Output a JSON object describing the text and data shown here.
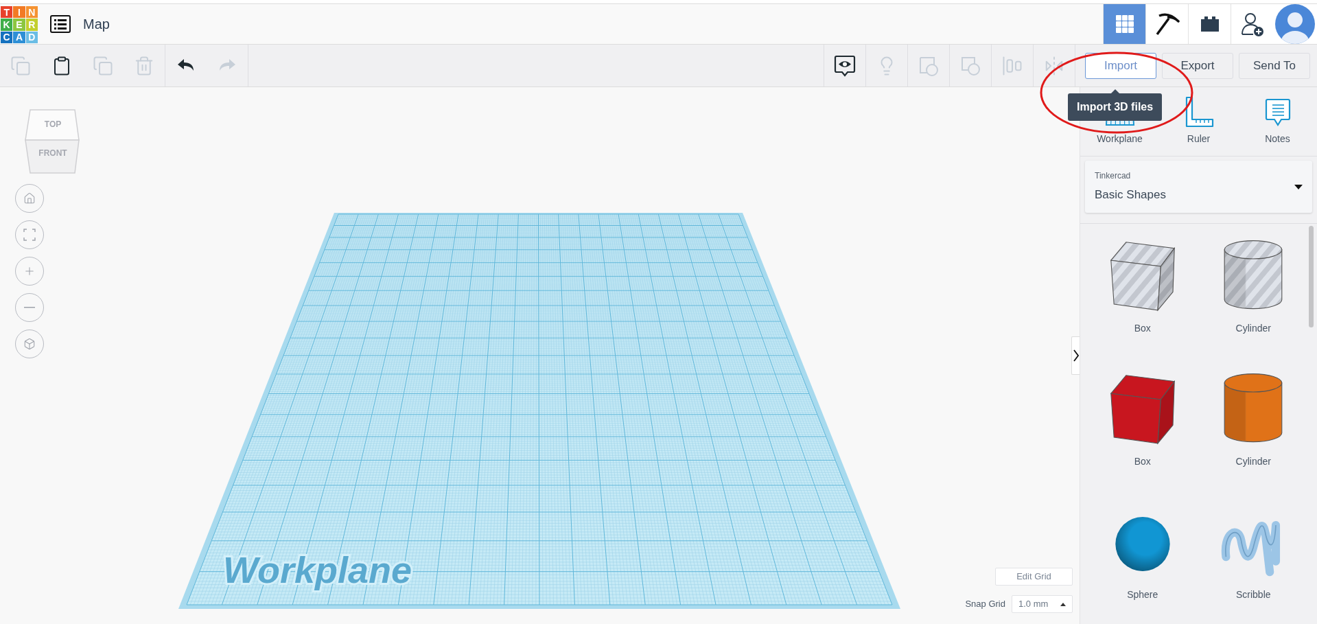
{
  "logo": {
    "letters": [
      {
        "char": "T",
        "color": "#e8412c"
      },
      {
        "char": "I",
        "color": "#f27a24"
      },
      {
        "char": "N",
        "color": "#f59331"
      },
      {
        "char": "K",
        "color": "#3fae49"
      },
      {
        "char": "E",
        "color": "#8cc63f"
      },
      {
        "char": "R",
        "color": "#c3cf2e"
      },
      {
        "char": "C",
        "color": "#1571bf"
      },
      {
        "char": "A",
        "color": "#2e8fd6"
      },
      {
        "char": "D",
        "color": "#6bbde5"
      }
    ]
  },
  "header": {
    "title": "Map",
    "modes": [
      {
        "kind": "grid",
        "selected": true
      },
      {
        "kind": "pickaxe",
        "selected": false
      },
      {
        "kind": "brick",
        "selected": false
      }
    ]
  },
  "toolbar": {
    "edit_tools": [
      {
        "kind": "copy",
        "disabled": true
      },
      {
        "kind": "paste",
        "disabled": false
      },
      {
        "kind": "duplicate",
        "disabled": true
      },
      {
        "kind": "delete",
        "disabled": true
      }
    ],
    "history_tools": [
      {
        "kind": "undo",
        "disabled": false
      },
      {
        "kind": "redo",
        "disabled": true
      }
    ],
    "view_tools": [
      {
        "kind": "notes",
        "disabled": false
      },
      {
        "kind": "bulb",
        "disabled": true
      },
      {
        "kind": "group",
        "disabled": true
      },
      {
        "kind": "ungroup",
        "disabled": true
      },
      {
        "kind": "align",
        "disabled": true
      },
      {
        "kind": "mirror",
        "disabled": true
      }
    ],
    "actions": [
      {
        "label": "Import",
        "hovered": true
      },
      {
        "label": "Export",
        "hovered": false
      },
      {
        "label": "Send To",
        "hovered": false
      }
    ]
  },
  "tooltip": "Import 3D files",
  "panel": {
    "tools": [
      {
        "kind": "workplane",
        "label": "Workplane"
      },
      {
        "kind": "ruler",
        "label": "Ruler"
      },
      {
        "kind": "notes",
        "label": "Notes"
      }
    ],
    "library": {
      "source": "Tinkercad",
      "name": "Basic Shapes"
    },
    "shapes": [
      {
        "kind": "box",
        "label": "Box",
        "hole": true,
        "color": "#c3c7cf"
      },
      {
        "kind": "cylinder",
        "label": "Cylinder",
        "hole": true,
        "color": "#c3c7cf"
      },
      {
        "kind": "box",
        "label": "Box",
        "hole": false,
        "color": "#c8161f"
      },
      {
        "kind": "cylinder",
        "label": "Cylinder",
        "hole": false,
        "color": "#e07218"
      },
      {
        "kind": "sphere",
        "label": "Sphere",
        "hole": false,
        "color": "#1196d3"
      },
      {
        "kind": "scribble",
        "label": "Scribble",
        "hole": false,
        "color": "#9cc5e6"
      }
    ]
  },
  "view_cube": {
    "top": "TOP",
    "front": "FRONT"
  },
  "workplane": {
    "label": "Workplane"
  },
  "grid": {
    "edit": "Edit Grid",
    "snap_label": "Snap Grid",
    "snap_value": "1.0 mm"
  }
}
